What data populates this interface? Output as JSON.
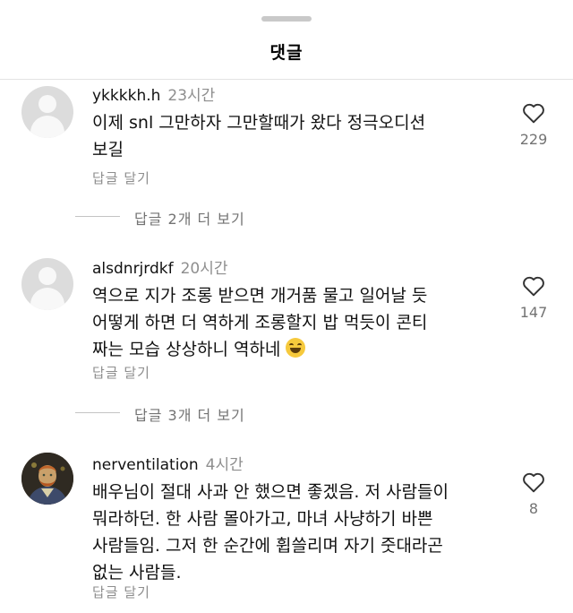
{
  "header": {
    "title": "댓글"
  },
  "comments": [
    {
      "username": "ykkkkh.h",
      "time": "23시간",
      "lines": [
        "이제 snl 그만하자 그만할때가 왔다 정극오디션",
        "보길"
      ],
      "reply_label": "답글 달기",
      "likes": "229",
      "view_replies": "답글 2개 더 보기"
    },
    {
      "username": "alsdnrjrdkf",
      "time": "20시간",
      "lines": [
        "역으로 지가 조롱 받으면 개거품 물고 일어날 듯",
        "어떻게 하면 더 역하게 조롱할지 밥 먹듯이 콘티",
        "짜는 모습 상상하니 역하네"
      ],
      "reply_label": "답글 달기",
      "likes": "147",
      "view_replies": "답글 3개 더 보기"
    },
    {
      "username": "nerventilation",
      "time": "4시간",
      "lines": [
        "배우님이 절대 사과 안 했으면 좋겠음. 저 사람들이",
        "뭐라하던. 한 사람 몰아가고, 마녀 사냥하기 바쁜",
        "사람들임. 그저 한 순간에 휩쓸리며 자기 줏대라곤",
        "없는 사람들."
      ],
      "reply_label": "답글 달기",
      "likes": "8"
    }
  ],
  "icons": {
    "like": "heart-outline-icon",
    "emoji": "grinning-sweat-emoji",
    "avatar_default": "default-profile-icon"
  }
}
